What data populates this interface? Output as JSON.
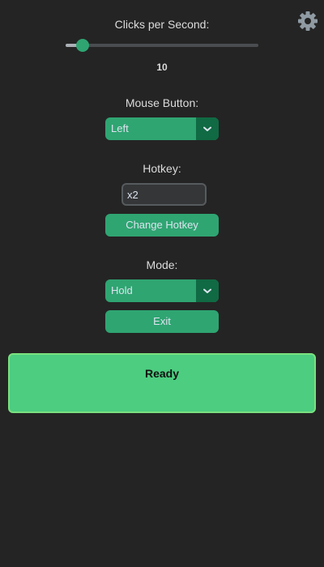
{
  "settings": {
    "icon": "gear-icon",
    "color": "#8f9aa3"
  },
  "cps": {
    "label": "Clicks per Second:",
    "value": "10",
    "slider_fraction": 0.09
  },
  "mouse_button": {
    "label": "Mouse Button:",
    "selected": "Left"
  },
  "hotkey": {
    "label": "Hotkey:",
    "value": "x2",
    "change_button": "Change Hotkey"
  },
  "mode": {
    "label": "Mode:",
    "selected": "Hold"
  },
  "exit_button": "Exit",
  "status": {
    "text": "Ready",
    "color": "#4ccd80"
  }
}
